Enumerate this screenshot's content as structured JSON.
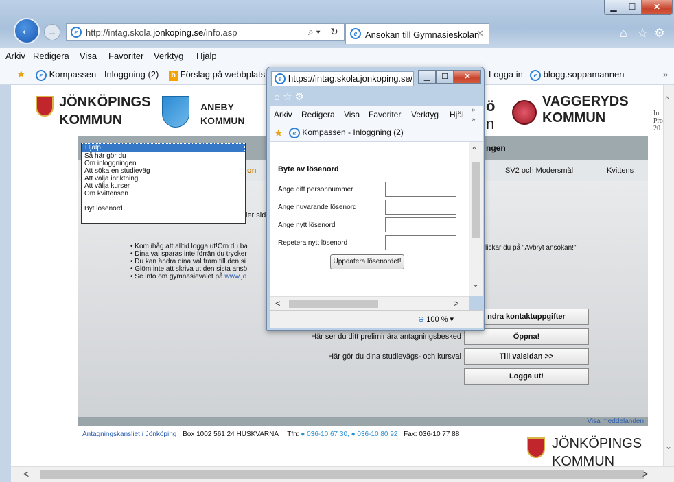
{
  "browser": {
    "url_prefix": "http://intag.skola.",
    "url_domain": "jonkoping.se",
    "url_suffix": "/info.asp",
    "tab_title": "Ansökan till Gymnasieskolan",
    "menu": [
      "Arkiv",
      "Redigera",
      "Visa",
      "Favoriter",
      "Verktyg",
      "Hjälp"
    ],
    "favorites": [
      "Kompassen - Inloggning (2)",
      "Förslag på webbplats",
      "Logga in",
      "blogg.soppamannen"
    ]
  },
  "logos": {
    "jonkoping": [
      "JÖNKÖPINGS",
      "KOMMUN"
    ],
    "aneby": [
      "ANEBY",
      "KOMMUN"
    ],
    "vaggeryd": [
      "VAGGERYDS",
      "KOMMUN"
    ],
    "partial_o": "ö",
    "partial_n": "n",
    "right_edge": [
      "In",
      "Pro",
      "20"
    ]
  },
  "nav": {
    "band_title_fragment": "ngen",
    "tab_fragment": "on",
    "tab_sv2": "SV2 och Modersmål",
    "tab_kvittens": "Kvittens"
  },
  "dropdown": {
    "items": [
      "Hjälp",
      "Så här gör du",
      "Om inloggningen",
      "Att söka en studieväg",
      "Att välja inriktning",
      "Att välja kurser",
      "Om kvittensen",
      "Byt lösenord"
    ]
  },
  "content": {
    "side_fragment": "ler sid",
    "bullets": [
      "Kom ihåg att alltid logga ut!Om du ba",
      "Dina val sparas inte förrän du trycker",
      "Du kan ändra dina val fram till den si",
      "Glöm inte att skriva ut den sista ansö",
      "Se info om gymnasievalet på "
    ],
    "bullet_link": "www.jo",
    "cancel_hint": "klickar du på \"Avbryt ansökan!\"",
    "row_labels": [
      "Här ser du ditt preliminära antagningsbesked",
      "Här gör du dina studievägs- och kursval"
    ],
    "buttons": [
      "ndra kontaktuppgifter",
      "Öppna!",
      "Till valsidan >>",
      "Logga ut!"
    ],
    "visa_meddelanden": "Visa meddelanden"
  },
  "footer": {
    "office": "Antagningskansliet i Jönköping",
    "address": "Box 1002   561 24 HUSKVARNA",
    "tfn_label": "Tfn:",
    "phone1": "036-10 67 30,",
    "phone2": "036-10 80 92",
    "fax": "Fax: 036-10 77 88"
  },
  "popup": {
    "url": "https://intag.skola.jonkoping.se/...",
    "menu": [
      "Arkiv",
      "Redigera",
      "Visa",
      "Favoriter",
      "Verktyg",
      "Hjäl"
    ],
    "favorite": "Kompassen - Inloggning (2)",
    "heading": "Byte av lösenord",
    "fields": [
      "Ange ditt personnummer",
      "Ange nuvarande lösenord",
      "Ange nytt lösenord",
      "Repetera nytt lösenord"
    ],
    "submit": "Uppdatera lösenordet!",
    "zoom": "100 %"
  }
}
